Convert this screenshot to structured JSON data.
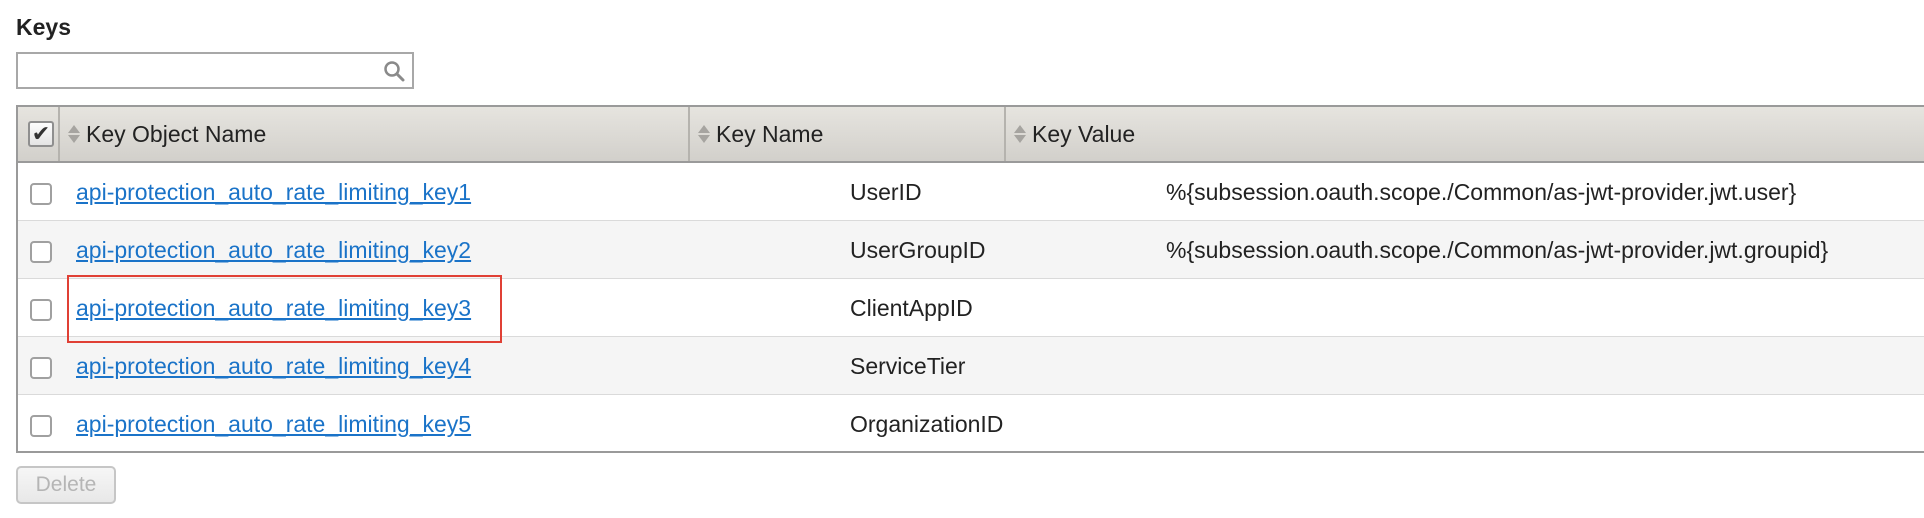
{
  "section": {
    "title": "Keys"
  },
  "search": {
    "value": "",
    "placeholder": "",
    "icon": "search-icon"
  },
  "table": {
    "select_all_checked": true,
    "columns": [
      {
        "label": "Key Object Name",
        "sortable": true
      },
      {
        "label": "Key Name",
        "sortable": true
      },
      {
        "label": "Key Value",
        "sortable": true
      }
    ],
    "rows": [
      {
        "object_name": "api-protection_auto_rate_limiting_key1",
        "key_name": "UserID",
        "key_value": "%{subsession.oauth.scope./Common/as-jwt-provider.jwt.user}",
        "checked": false
      },
      {
        "object_name": "api-protection_auto_rate_limiting_key2",
        "key_name": "UserGroupID",
        "key_value": "%{subsession.oauth.scope./Common/as-jwt-provider.jwt.groupid}",
        "checked": false
      },
      {
        "object_name": "api-protection_auto_rate_limiting_key3",
        "key_name": "ClientAppID",
        "key_value": "",
        "checked": false
      },
      {
        "object_name": "api-protection_auto_rate_limiting_key4",
        "key_name": "ServiceTier",
        "key_value": "",
        "checked": false
      },
      {
        "object_name": "api-protection_auto_rate_limiting_key5",
        "key_name": "OrganizationID",
        "key_value": "",
        "checked": false
      }
    ],
    "highlighted_row": 2
  },
  "actions": {
    "delete_label": "Delete",
    "delete_enabled": false
  },
  "colors": {
    "link": "#1a73c8",
    "highlight_border": "#e04035",
    "header_bg": "#dcdad5",
    "alt_row_bg": "#f5f5f5"
  }
}
